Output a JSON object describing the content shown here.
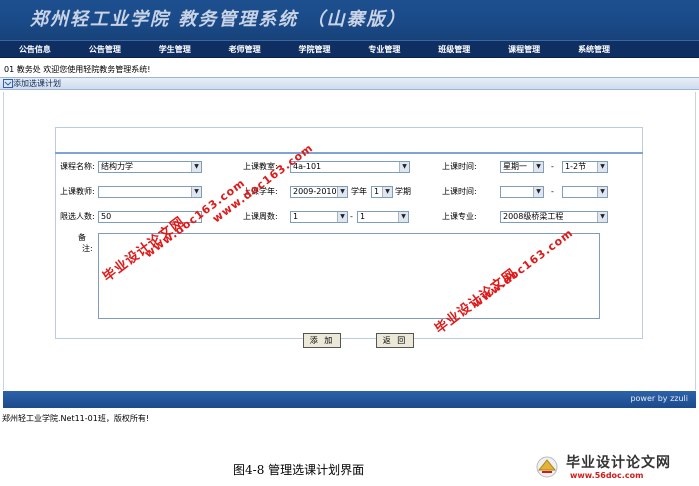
{
  "header": {
    "title": "郑州轻工业学院  教务管理系统  （山寨版）"
  },
  "nav": {
    "items": [
      "公告信息",
      "公告管理",
      "学生管理",
      "老师管理",
      "学院管理",
      "专业管理",
      "班级管理",
      "课程管理",
      "系统管理"
    ]
  },
  "welcome_text": "01 教务处 欢迎您使用轻院教务管理系统!",
  "panel": {
    "title": "添加选课计划"
  },
  "form": {
    "course_name_label": "课程名称:",
    "course_name_value": "结构力学",
    "classroom_label": "上课教室:",
    "classroom_value": "4a-101",
    "time1_label": "上课时间:",
    "time1_day": "星期一",
    "time1_period": "1-2节",
    "teacher_label": "上课教师:",
    "teacher_value": "",
    "year_label": "上课学年:",
    "year_value": "2009-2010",
    "term_label": "学年",
    "term_value": "1",
    "term_suffix": "学期",
    "time2_label": "上课时间:",
    "time2_day": "",
    "time2_period": "",
    "dash": "-",
    "limit_label": "限选人数:",
    "limit_value": "50",
    "weeks_label": "上课周数:",
    "weeks_from": "1",
    "weeks_to": "1",
    "major_label": "上课专业:",
    "major_value": "2008级桥梁工程",
    "remark_label1": "备",
    "remark_label2": "注:",
    "add_button": "添 加",
    "back_button": "返 回"
  },
  "footer": {
    "power": "power  by zzuli",
    "copyright": "郑州轻工业学院.Net11-01班，版权所有!"
  },
  "caption": "图4-8  管理选课计划界面",
  "watermarks": {
    "cn": "毕业设计论文网",
    "url": "www.doc163.com"
  },
  "logo": {
    "name": "毕业设计论文网",
    "url": "www.56doc.com"
  },
  "colors": {
    "banner": "#1a4a88",
    "navbar": "#0f2f63",
    "watermark": "#e01919"
  }
}
